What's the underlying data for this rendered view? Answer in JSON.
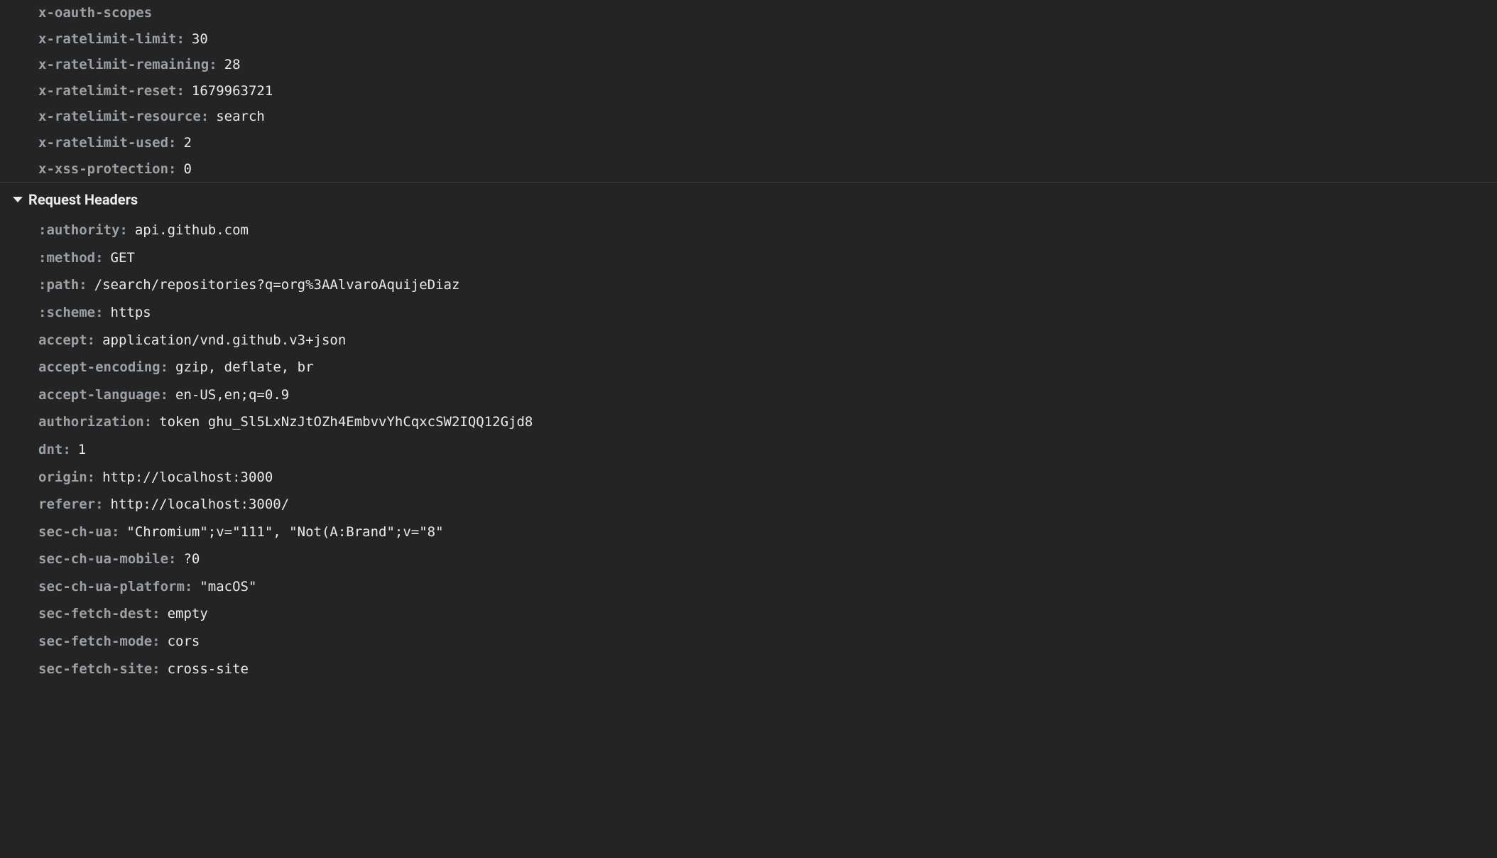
{
  "responseHeaders": {
    "items": [
      {
        "name": "x-oauth-scopes",
        "value": ""
      },
      {
        "name": "x-ratelimit-limit",
        "value": "30"
      },
      {
        "name": "x-ratelimit-remaining",
        "value": "28"
      },
      {
        "name": "x-ratelimit-reset",
        "value": "1679963721"
      },
      {
        "name": "x-ratelimit-resource",
        "value": "search"
      },
      {
        "name": "x-ratelimit-used",
        "value": "2"
      },
      {
        "name": "x-xss-protection",
        "value": "0"
      }
    ]
  },
  "requestHeaders": {
    "title": "Request Headers",
    "items": [
      {
        "name": ":authority",
        "value": "api.github.com"
      },
      {
        "name": ":method",
        "value": "GET"
      },
      {
        "name": ":path",
        "value": "/search/repositories?q=org%3AAlvaroAquijeDiaz"
      },
      {
        "name": ":scheme",
        "value": "https"
      },
      {
        "name": "accept",
        "value": "application/vnd.github.v3+json"
      },
      {
        "name": "accept-encoding",
        "value": "gzip, deflate, br"
      },
      {
        "name": "accept-language",
        "value": "en-US,en;q=0.9"
      },
      {
        "name": "authorization",
        "value": "token ghu_Sl5LxNzJtOZh4EmbvvYhCqxcSW2IQQ12Gjd8"
      },
      {
        "name": "dnt",
        "value": "1"
      },
      {
        "name": "origin",
        "value": "http://localhost:3000"
      },
      {
        "name": "referer",
        "value": "http://localhost:3000/"
      },
      {
        "name": "sec-ch-ua",
        "value": "\"Chromium\";v=\"111\", \"Not(A:Brand\";v=\"8\""
      },
      {
        "name": "sec-ch-ua-mobile",
        "value": "?0"
      },
      {
        "name": "sec-ch-ua-platform",
        "value": "\"macOS\""
      },
      {
        "name": "sec-fetch-dest",
        "value": "empty"
      },
      {
        "name": "sec-fetch-mode",
        "value": "cors"
      },
      {
        "name": "sec-fetch-site",
        "value": "cross-site"
      }
    ]
  }
}
